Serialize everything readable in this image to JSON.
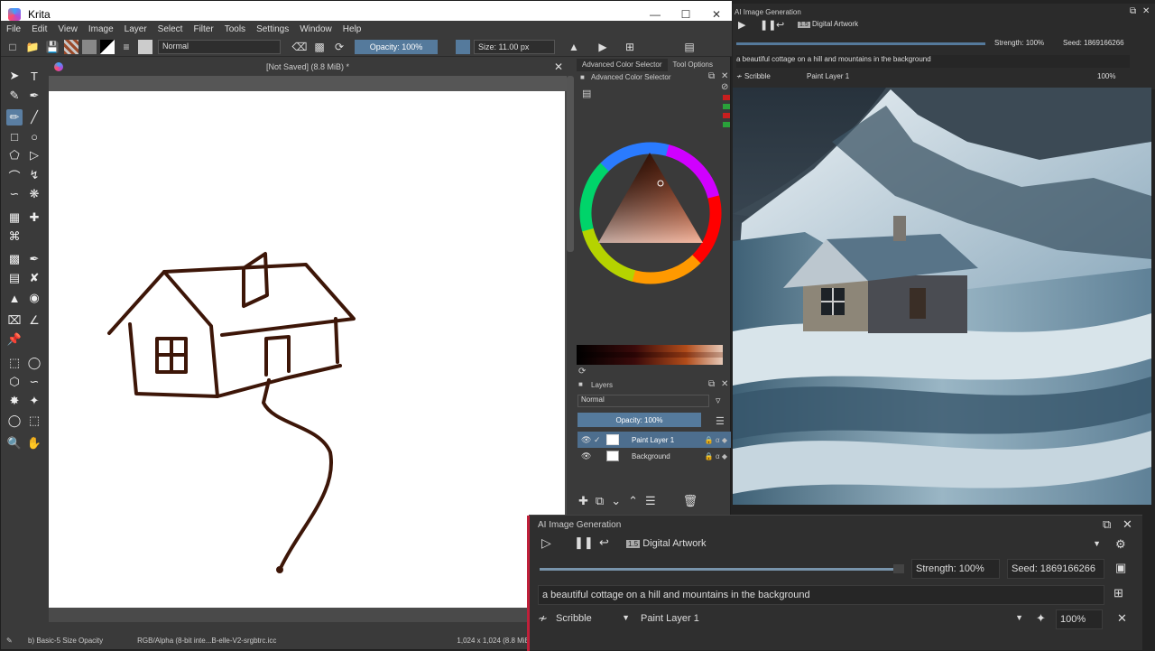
{
  "window": {
    "title": "Krita"
  },
  "menu": [
    "File",
    "Edit",
    "View",
    "Image",
    "Layer",
    "Select",
    "Filter",
    "Tools",
    "Settings",
    "Window",
    "Help"
  ],
  "toolbar": {
    "blend_mode": "Normal",
    "opacity": "Opacity: 100%",
    "size": "Size: 11.00 px"
  },
  "canvas": {
    "tab_title": "[Not Saved]  (8.8 MiB) *"
  },
  "status": {
    "brush": "b) Basic-5 Size Opacity",
    "color_profile": "RGB/Alpha (8-bit inte...B-elle-V2-srgbtrc.icc",
    "dimensions": "1,024 x 1,024 (8.8 MiB)"
  },
  "dockers": {
    "tab1": "Advanced Color Selector",
    "tab2": "Tool Options",
    "color_title": "Advanced Color Selector",
    "layers_title": "Layers",
    "layers_blend": "Normal",
    "layers_opacity": "Opacity:  100%",
    "layers": [
      {
        "name": "Paint Layer 1",
        "selected": true
      },
      {
        "name": "Background",
        "selected": false
      }
    ]
  },
  "ai_right": {
    "title": "AI Image Generation",
    "style": "Digital Artwork",
    "strength": "Strength: 100%",
    "seed": "Seed: 1869166266",
    "prompt": "a beautiful cottage on a hill and mountains in the background",
    "control": "Scribble",
    "layer": "Paint Layer 1",
    "zoom": "100%"
  },
  "ai_float": {
    "title": "AI Image Generation",
    "style": "Digital Artwork",
    "strength": "Strength: 100%",
    "seed": "Seed: 1869166266",
    "prompt": "a beautiful cottage on a hill and mountains in the background",
    "control": "Scribble",
    "layer": "Paint Layer 1",
    "zoom": "100%"
  },
  "colors": {
    "accent": "#557a9c",
    "stroke": "#3d1608"
  }
}
